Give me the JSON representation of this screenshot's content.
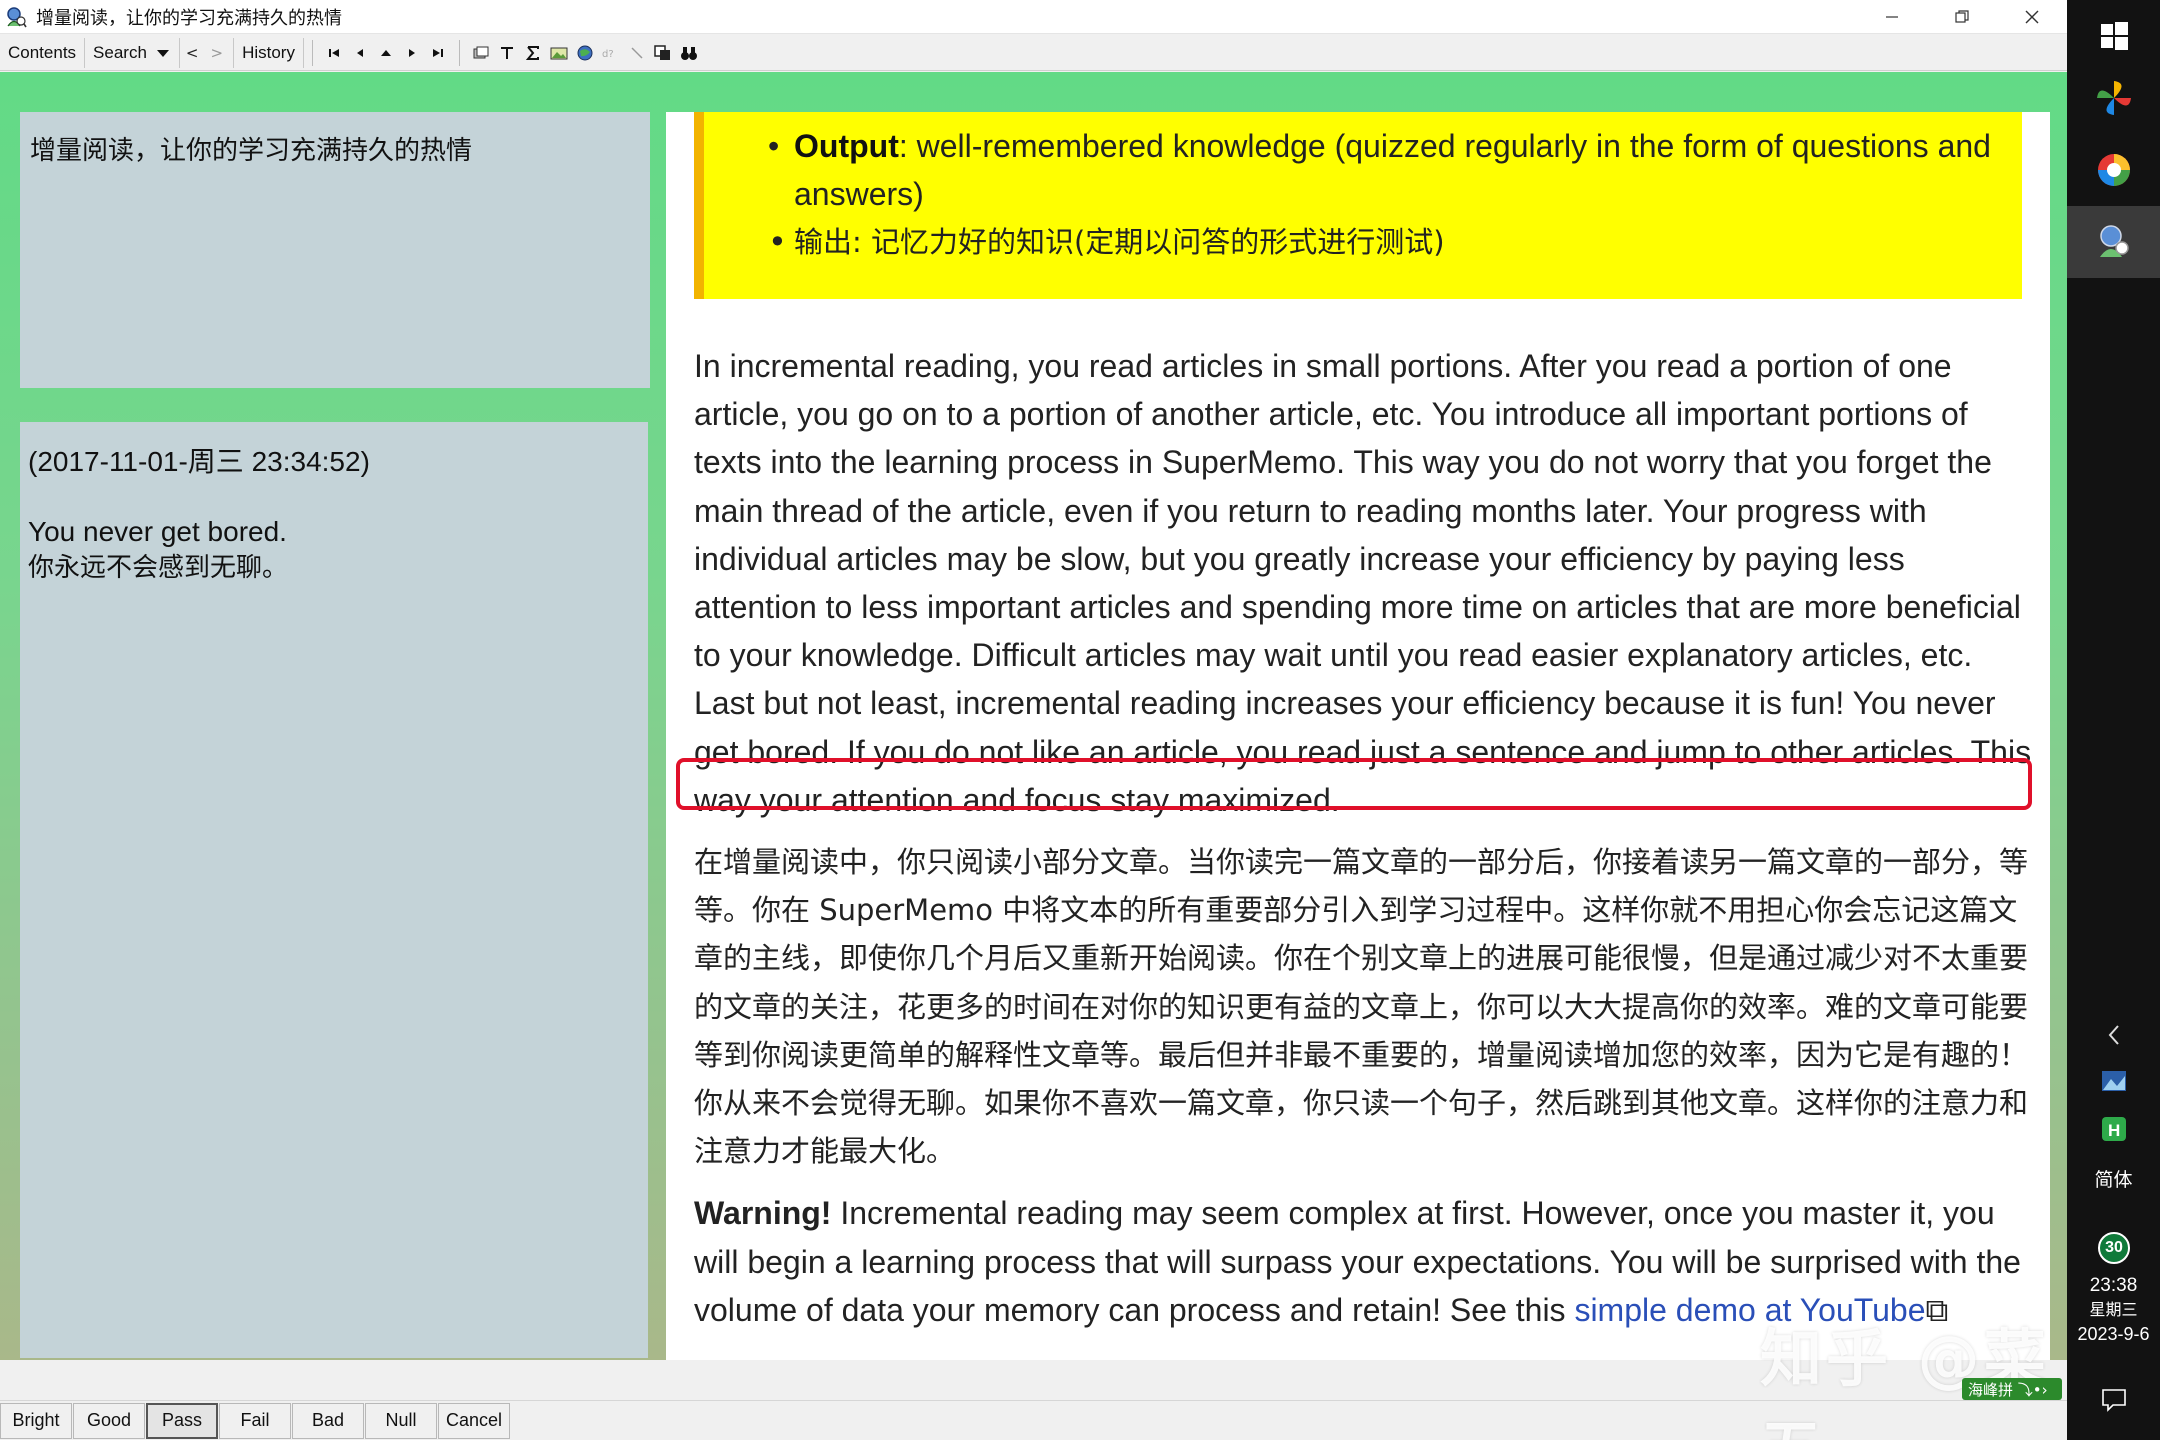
{
  "window": {
    "title": "增量阅读，让你的学习充满持久的热情"
  },
  "toolbar": {
    "contents_label": "Contents",
    "search_label": "Search",
    "back_label": "<",
    "forward_label": ">",
    "history_label": "History"
  },
  "title_panel": {
    "text": "增量阅读，让你的学习充满持久的热情"
  },
  "answer_panel": {
    "timestamp": "(2017-11-01-周三 23:34:52)",
    "answer_en": "You never get bored.",
    "answer_cn": "你永远不会感到无聊。"
  },
  "article": {
    "highlight": {
      "item1_bold": "Output",
      "item1_rest": ": well-remembered knowledge (quizzed regularly in the form of questions and answers)",
      "item2": "输出: 记忆力好的知识(定期以问答的形式进行测试)"
    },
    "para1": "In incremental reading, you read articles in small portions. After you read a portion of one article, you go on to a portion of another article, etc. You introduce all important portions of texts into the learning process in SuperMemo. This way you do not worry that you forget the main thread of the article, even if you return to reading months later. Your progress with individual articles may be slow, but you greatly increase your efficiency by paying less attention to less important articles and spending more time on articles that are more beneficial to your knowledge. Difficult articles may wait until you read easier explanatory articles, etc. Last but not least, incremental reading increases your efficiency because it is fun! You never get bored. If you do not like an article, you read just a sentence and jump to other articles. This way your attention and focus stay maximized.",
    "para2": "在增量阅读中，你只阅读小部分文章。当你读完一篇文章的一部分后，你接着读另一篇文章的一部分，等等。你在 SuperMemo 中将文本的所有重要部分引入到学习过程中。这样你就不用担心你会忘记这篇文章的主线，即使你几个月后又重新开始阅读。你在个别文章上的进展可能很慢，但是通过减少对不太重要的文章的关注，花更多的时间在对你的知识更有益的文章上，你可以大大提高你的效率。难的文章可能要等到你阅读更简单的解释性文章等。最后但并非最不重要的，增量阅读增加您的效率，因为它是有趣的！你从来不会觉得无聊。如果你不喜欢一篇文章，你只读一个句子，然后跳到其他文章。这样你的注意力和注意力才能最大化。",
    "warning_bold": "Warning!",
    "warning_text": " Incremental reading may seem complex at first. However, once you master it, you will begin a learning process that will surpass your expectations. You will be surprised with the volume of data your memory can process and retain! See this ",
    "warning_link": "simple demo at YouTube"
  },
  "grades": [
    "Bright",
    "Good",
    "Pass",
    "Fail",
    "Bad",
    "Null",
    "Cancel"
  ],
  "watermark": "知乎 @菜五",
  "ime_badge": "海峰拼 ⤵•›",
  "taskbar": {
    "language": "简体",
    "badge": "30",
    "time": "23:38",
    "day": "星期三",
    "date": "2023-9-6"
  },
  "colors": {
    "highlight": "#ffff00",
    "highlight_border": "#f2b400",
    "red_box": "#e0102a",
    "green_bg": "#62da86",
    "panel": "#c4d3d8",
    "link": "#2a4fb8"
  }
}
